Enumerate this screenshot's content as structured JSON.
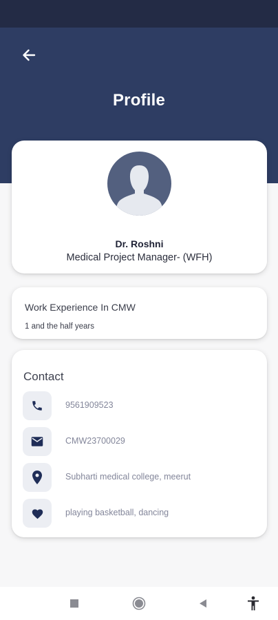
{
  "header": {
    "title": "Profile",
    "back_icon": "arrow-left-icon"
  },
  "profile": {
    "avatar_icon": "person-silhouette-icon",
    "name": "Dr. Roshni",
    "role": "Medical Project Manager- (WFH)"
  },
  "experience": {
    "title": "Work Experience In CMW",
    "value": "1 and the half years"
  },
  "contact": {
    "title": "Contact",
    "items": [
      {
        "icon": "phone-icon",
        "text": "9561909523"
      },
      {
        "icon": "mail-icon",
        "text": "CMW23700029"
      },
      {
        "icon": "location-pin-icon",
        "text": "Subharti medical college, meerut"
      },
      {
        "icon": "heart-icon",
        "text": "playing basketball, dancing"
      }
    ]
  },
  "nav_bar": {
    "buttons": [
      "recents-square-icon",
      "home-circle-icon",
      "back-triangle-icon",
      "accessibility-icon"
    ]
  },
  "colors": {
    "header_bg": "#2e3d63",
    "status_bar_bg": "#232b45",
    "avatar_bg": "#53607f",
    "icon_color": "#1f2d57",
    "page_bg": "#f7f7f8"
  }
}
